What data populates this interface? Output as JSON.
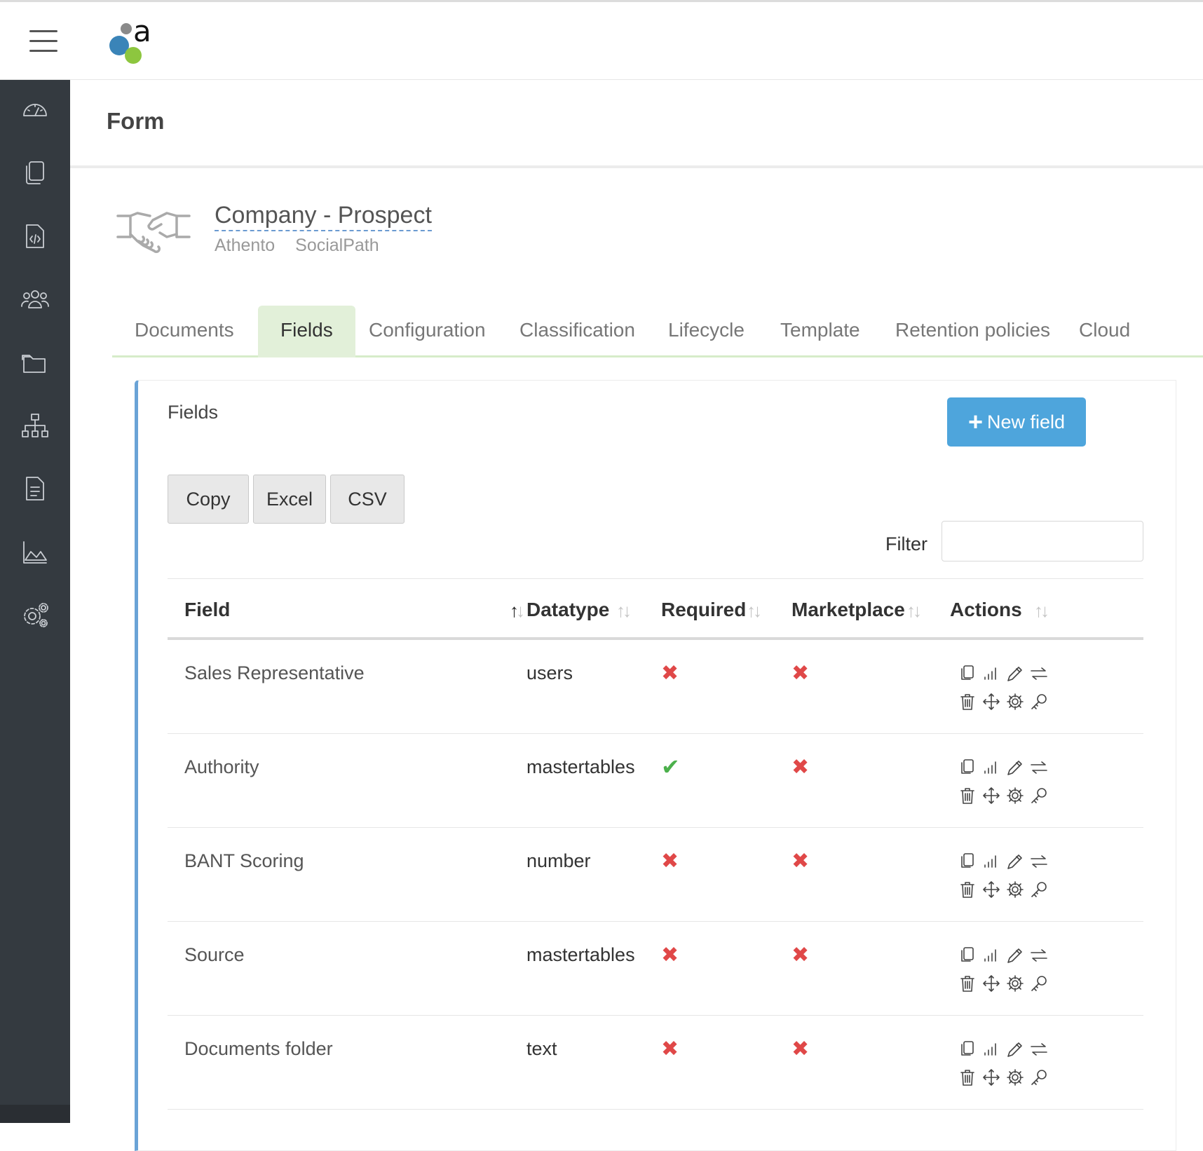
{
  "header": {
    "menu_icon": "hamburger-icon",
    "logo_icon": "athento-logo"
  },
  "sidebar": {
    "items": [
      {
        "name": "dashboard",
        "icon": "speedometer-icon"
      },
      {
        "name": "documents",
        "icon": "copy-icon"
      },
      {
        "name": "forms",
        "icon": "file-code-icon"
      },
      {
        "name": "users",
        "icon": "people-icon"
      },
      {
        "name": "folders",
        "icon": "folder-icon"
      },
      {
        "name": "hierarchy",
        "icon": "sitemap-icon"
      },
      {
        "name": "reports",
        "icon": "file-text-icon"
      },
      {
        "name": "stats",
        "icon": "area-chart-icon"
      },
      {
        "name": "settings",
        "icon": "gears-icon"
      }
    ]
  },
  "page": {
    "title": "Form"
  },
  "doctype": {
    "icon": "handshake-icon",
    "title": "Company - Prospect",
    "tags": [
      "Athento",
      "SocialPath"
    ]
  },
  "tabs": [
    {
      "label": "Documents",
      "active": false
    },
    {
      "label": "Fields",
      "active": true
    },
    {
      "label": "Configuration",
      "active": false
    },
    {
      "label": "Classification",
      "active": false
    },
    {
      "label": "Lifecycle",
      "active": false
    },
    {
      "label": "Template",
      "active": false
    },
    {
      "label": "Retention policies",
      "active": false
    },
    {
      "label": "Cloud",
      "active": false
    }
  ],
  "panel": {
    "title": "Fields",
    "new_button": {
      "plus": "+",
      "label": "New field"
    },
    "export_buttons": [
      "Copy",
      "Excel",
      "CSV"
    ],
    "filter_label": "Filter",
    "filter_value": ""
  },
  "table": {
    "columns": [
      "Field",
      "Datatype",
      "Required",
      "Marketplace",
      "Actions"
    ],
    "sort_state": {
      "column": "Field",
      "direction": "asc"
    },
    "rows": [
      {
        "field": "Sales Representative",
        "datatype": "users",
        "required": false,
        "marketplace": false
      },
      {
        "field": "Authority",
        "datatype": "mastertables",
        "required": true,
        "marketplace": false
      },
      {
        "field": "BANT Scoring",
        "datatype": "number",
        "required": false,
        "marketplace": false
      },
      {
        "field": "Source",
        "datatype": "mastertables",
        "required": false,
        "marketplace": false
      },
      {
        "field": "Documents folder",
        "datatype": "text",
        "required": false,
        "marketplace": false
      }
    ],
    "row_actions": [
      "copy-icon",
      "signal-icon",
      "pencil-icon",
      "swap-icon",
      "trash-icon",
      "move-icon",
      "gear-icon",
      "key-icon"
    ]
  },
  "colors": {
    "sidebar_bg": "#343a40",
    "tab_active_bg": "#e2f0d9",
    "primary_button": "#4ea5dc",
    "panel_accent": "#6aa3d6",
    "false_mark": "#e04848",
    "true_mark": "#4cb04c"
  }
}
